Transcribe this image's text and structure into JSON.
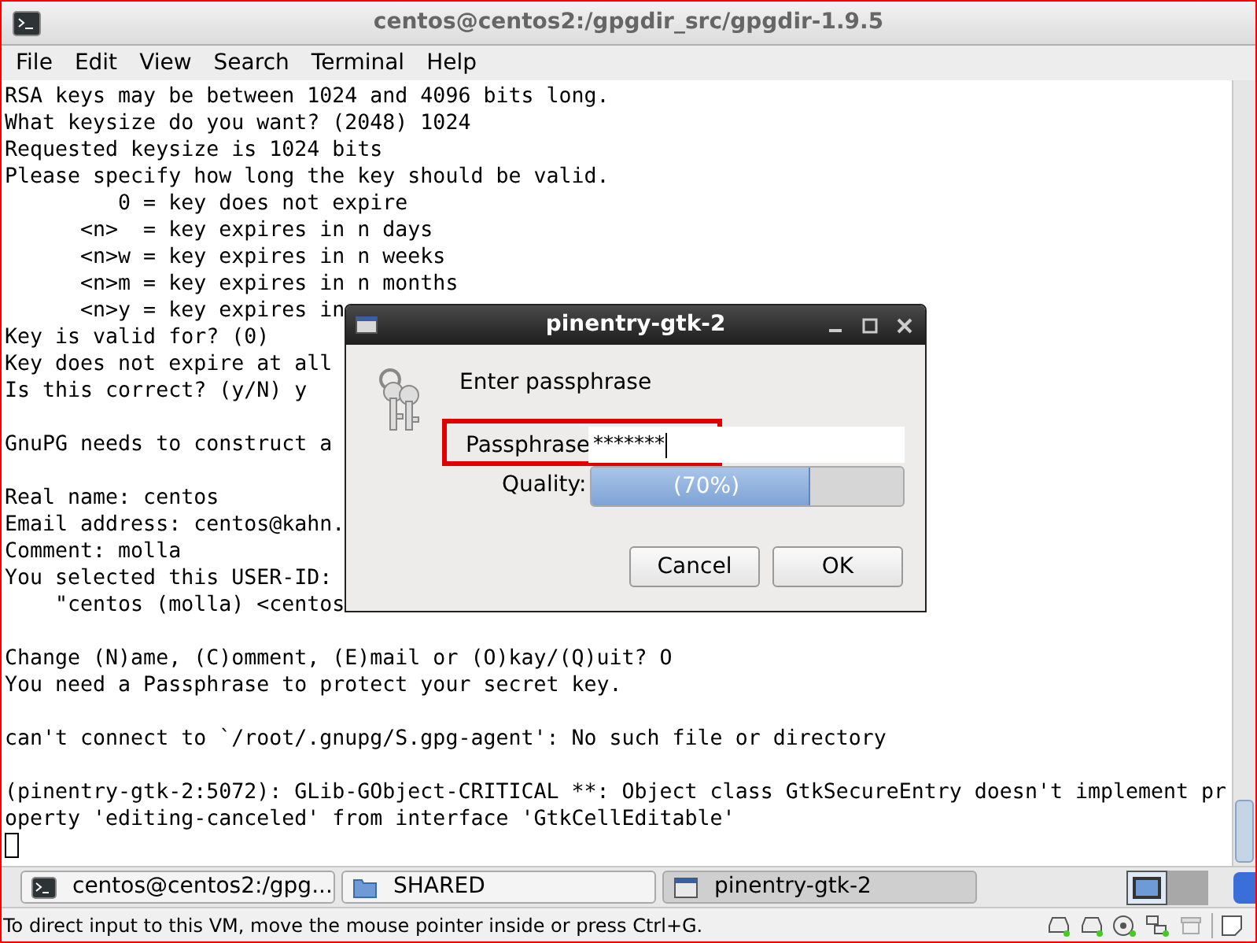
{
  "window": {
    "title": "centos@centos2:/gpgdir_src/gpgdir-1.9.5"
  },
  "menu": [
    "File",
    "Edit",
    "View",
    "Search",
    "Terminal",
    "Help"
  ],
  "terminal": {
    "lines": [
      {
        "kind": "text",
        "text": "RSA keys may be between 1024 and 4096 bits long."
      },
      {
        "kind": "text",
        "text": "What keysize do you want? (2048) 1024"
      },
      {
        "kind": "text",
        "text": "Requested keysize is 1024 bits"
      },
      {
        "kind": "text",
        "text": "Please specify how long the key should be valid."
      },
      {
        "kind": "text",
        "text": "         0 = key does not expire"
      },
      {
        "kind": "text",
        "text": "      <n>  = key expires in n days"
      },
      {
        "kind": "text",
        "text": "      <n>w = key expires in n weeks"
      },
      {
        "kind": "text",
        "text": "      <n>m = key expires in n months"
      },
      {
        "kind": "text",
        "text": "      <n>y = key expires in"
      },
      {
        "kind": "text",
        "text": "Key is valid for? (0)"
      },
      {
        "kind": "text",
        "text": "Key does not expire at all"
      },
      {
        "kind": "text",
        "text": "Is this correct? (y/N) y"
      },
      {
        "kind": "blank"
      },
      {
        "kind": "text",
        "text": "GnuPG needs to construct a"
      },
      {
        "kind": "blank"
      },
      {
        "kind": "text",
        "text": "Real name: centos"
      },
      {
        "kind": "text",
        "text": "Email address: centos@kahn."
      },
      {
        "kind": "text",
        "text": "Comment: molla"
      },
      {
        "kind": "text",
        "text": "You selected this USER-ID:"
      },
      {
        "kind": "text",
        "text": "    \"centos (molla) <centos"
      },
      {
        "kind": "blank"
      },
      {
        "kind": "text",
        "text": "Change (N)ame, (C)omment, (E)mail or (O)kay/(Q)uit? O"
      },
      {
        "kind": "text",
        "text": "You need a Passphrase to protect your secret key."
      },
      {
        "kind": "blank"
      },
      {
        "kind": "text",
        "text": "can't connect to `/root/.gnupg/S.gpg-agent': No such file or directory"
      },
      {
        "kind": "blank"
      },
      {
        "kind": "text",
        "text": "(pinentry-gtk-2:5072): GLib-GObject-CRITICAL **: Object class GtkSecureEntry doesn't implement pr"
      },
      {
        "kind": "text",
        "text": "operty 'editing-canceled' from interface 'GtkCellEditable'"
      },
      {
        "kind": "cursor"
      }
    ]
  },
  "dialog": {
    "title": "pinentry-gtk-2",
    "prompt": "Enter passphrase",
    "passphrase_label": "Passphrase",
    "passphrase_value": "*******",
    "highlighted": true,
    "quality_label": "Quality:",
    "quality": {
      "level": 0.7,
      "reading": "(70%)"
    },
    "buttons": [
      "Cancel",
      "OK"
    ]
  },
  "taskbar": [
    {
      "kind": "terminal",
      "label": "centos@centos2:/gpg...",
      "selected": false
    },
    {
      "kind": "folder",
      "label": "SHARED",
      "selected": false
    },
    {
      "kind": "window",
      "label": "pinentry-gtk-2",
      "selected": true
    }
  ],
  "workspaces": [
    {
      "selected": true
    },
    {
      "selected": false
    }
  ],
  "status_bar": {
    "text": "To direct input to this VM, move the mouse pointer inside or press Ctrl+G."
  }
}
